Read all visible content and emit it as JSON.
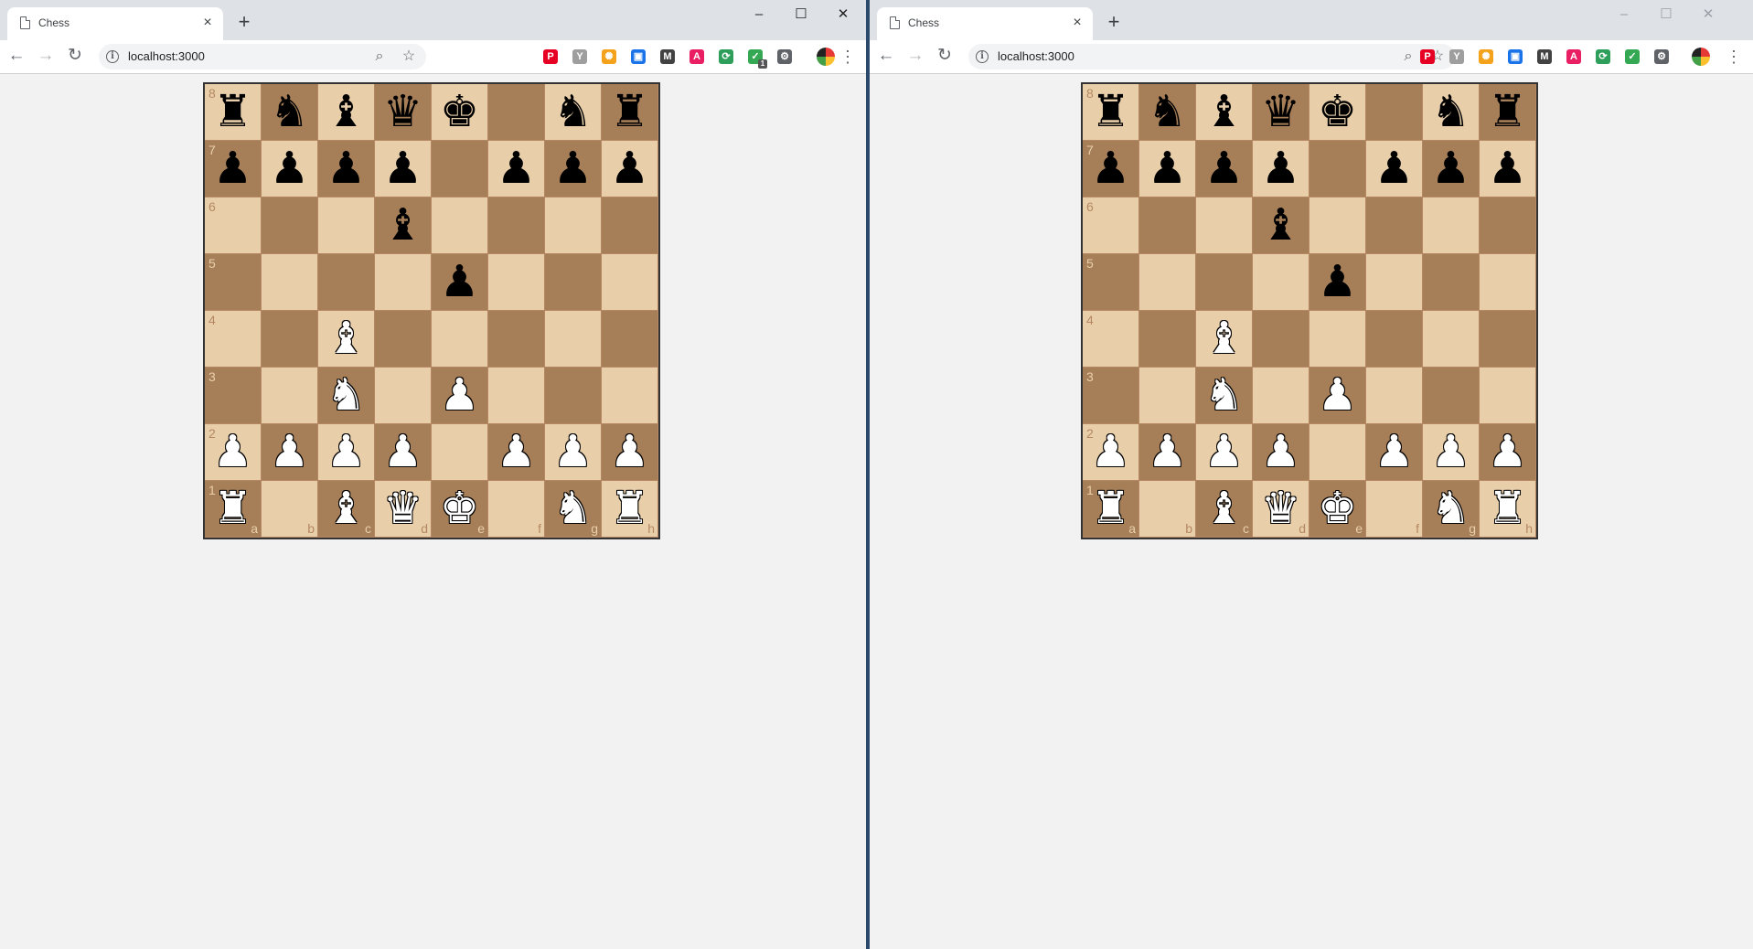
{
  "windows": [
    {
      "id": "left",
      "tab_title": "Chess",
      "url": "localhost:3000",
      "extension_badge": "1",
      "controls_style": "dark"
    },
    {
      "id": "right",
      "tab_title": "Chess",
      "url": "localhost:3000",
      "extension_badge": "",
      "controls_style": "faint"
    }
  ],
  "icons": {
    "tab_close": "×",
    "new_tab": "+",
    "minimize": "–",
    "maximize": "☐",
    "close": "✕",
    "back": "←",
    "forward": "→",
    "reload": "↻",
    "zoom": "⌕",
    "star": "☆",
    "menu": "⋮",
    "info": "i"
  },
  "extensions": [
    {
      "name": "pinterest-icon",
      "glyph": "P",
      "color": "#e60023"
    },
    {
      "name": "funnel-icon",
      "glyph": "Y",
      "color": "#9e9e9e"
    },
    {
      "name": "sun-extension-icon",
      "glyph": "✺",
      "color": "#f4a21b"
    },
    {
      "name": "screen-extension-icon",
      "glyph": "▣",
      "color": "#1a73e8"
    },
    {
      "name": "m-extension-icon",
      "glyph": "M",
      "color": "#424242"
    },
    {
      "name": "a-extension-icon",
      "glyph": "A",
      "color": "#e91e63"
    },
    {
      "name": "sync-extension-icon",
      "glyph": "⟳",
      "color": "#2e9e5b"
    },
    {
      "name": "shield-extension-icon",
      "glyph": "✓",
      "color": "#34a853"
    },
    {
      "name": "settings-extension-icon",
      "glyph": "⚙",
      "color": "#5f6368"
    }
  ],
  "board": {
    "ranks": [
      "8",
      "7",
      "6",
      "5",
      "4",
      "3",
      "2",
      "1"
    ],
    "files": [
      "a",
      "b",
      "c",
      "d",
      "e",
      "f",
      "g",
      "h"
    ],
    "rows": [
      [
        "bR",
        "bN",
        "bB",
        "bQ",
        "bK",
        "",
        "bN",
        "bR"
      ],
      [
        "bP",
        "bP",
        "bP",
        "bP",
        "",
        "bP",
        "bP",
        "bP"
      ],
      [
        "",
        "",
        "",
        "bB",
        "",
        "",
        "",
        ""
      ],
      [
        "",
        "",
        "",
        "",
        "bP",
        "",
        "",
        ""
      ],
      [
        "",
        "",
        "wB",
        "",
        "",
        "",
        "",
        ""
      ],
      [
        "",
        "",
        "wN",
        "",
        "wP",
        "",
        "",
        ""
      ],
      [
        "wP",
        "wP",
        "wP",
        "wP",
        "",
        "wP",
        "wP",
        "wP"
      ],
      [
        "wR",
        "",
        "wB",
        "wQ",
        "wK",
        "",
        "wN",
        "wR"
      ]
    ]
  },
  "piece_glyphs": {
    "K": "♚",
    "Q": "♛",
    "R": "♜",
    "B": "♝",
    "N": "♞",
    "P": "♟"
  }
}
